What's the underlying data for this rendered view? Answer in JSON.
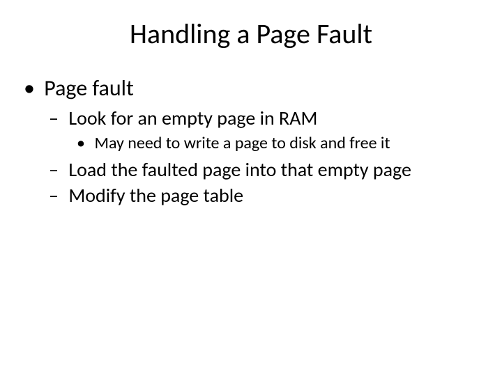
{
  "title": "Handling a Page Fault",
  "bullets": {
    "l1": "Page fault",
    "l2a": "Look for an empty page in RAM",
    "l3a": "May need to write a page to disk and free it",
    "l2b": "Load the faulted page into that empty page",
    "l2c": "Modify the page table"
  }
}
